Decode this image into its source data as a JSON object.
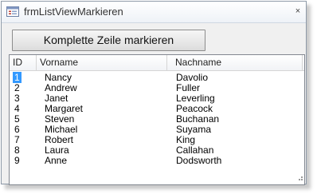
{
  "window": {
    "title": "frmListViewMarkieren",
    "close_glyph": "×"
  },
  "toolbar": {
    "select_row_label": "Komplette Zeile markieren"
  },
  "listview": {
    "columns": [
      "ID",
      "Vorname",
      "Nachname"
    ],
    "selected_row_id": "1",
    "selection_color": "#3399ff",
    "rows": [
      {
        "id": "1",
        "vorname": "Nancy",
        "nachname": "Davolio"
      },
      {
        "id": "2",
        "vorname": "Andrew",
        "nachname": "Fuller"
      },
      {
        "id": "3",
        "vorname": "Janet",
        "nachname": "Leverling"
      },
      {
        "id": "4",
        "vorname": "Margaret",
        "nachname": "Peacock"
      },
      {
        "id": "5",
        "vorname": "Steven",
        "nachname": "Buchanan"
      },
      {
        "id": "6",
        "vorname": "Michael",
        "nachname": "Suyama"
      },
      {
        "id": "7",
        "vorname": "Robert",
        "nachname": "King"
      },
      {
        "id": "8",
        "vorname": "Laura",
        "nachname": "Callahan"
      },
      {
        "id": "9",
        "vorname": "Anne",
        "nachname": "Dodsworth"
      }
    ]
  }
}
